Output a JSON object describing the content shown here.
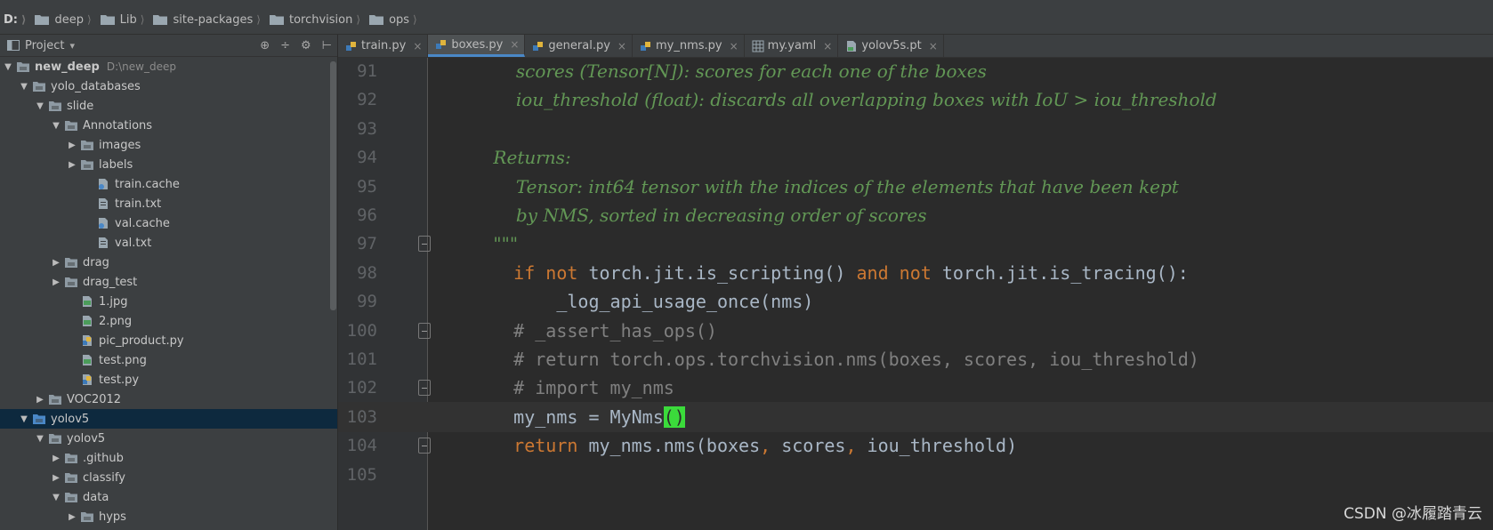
{
  "breadcrumb": [
    "D:",
    "deep",
    "Lib",
    "site-packages",
    "torchvision",
    "ops"
  ],
  "sidebar": {
    "title": "Project",
    "title_caret": "▾",
    "tools": [
      "⊕",
      "÷",
      "⚙",
      "⊢"
    ],
    "tree": [
      {
        "label": "new_deep",
        "sub": "D:\\new_deep",
        "depth": 0,
        "arrow": "▼",
        "icon": "folder",
        "bold": true
      },
      {
        "label": "yolo_databases",
        "depth": 1,
        "arrow": "▼",
        "icon": "folder"
      },
      {
        "label": "slide",
        "depth": 2,
        "arrow": "▼",
        "icon": "folder"
      },
      {
        "label": "Annotations",
        "depth": 3,
        "arrow": "▼",
        "icon": "folder"
      },
      {
        "label": "images",
        "depth": 4,
        "arrow": "▶",
        "icon": "folder"
      },
      {
        "label": "labels",
        "depth": 4,
        "arrow": "▶",
        "icon": "folder"
      },
      {
        "label": "train.cache",
        "depth": 5,
        "arrow": "",
        "icon": "file-gear"
      },
      {
        "label": "train.txt",
        "depth": 5,
        "arrow": "",
        "icon": "file-text"
      },
      {
        "label": "val.cache",
        "depth": 5,
        "arrow": "",
        "icon": "file-gear"
      },
      {
        "label": "val.txt",
        "depth": 5,
        "arrow": "",
        "icon": "file-text"
      },
      {
        "label": "drag",
        "depth": 3,
        "arrow": "▶",
        "icon": "folder"
      },
      {
        "label": "drag_test",
        "depth": 3,
        "arrow": "▶",
        "icon": "folder"
      },
      {
        "label": "1.jpg",
        "depth": 4,
        "arrow": "",
        "icon": "file-image"
      },
      {
        "label": "2.png",
        "depth": 4,
        "arrow": "",
        "icon": "file-image"
      },
      {
        "label": "pic_product.py",
        "depth": 4,
        "arrow": "",
        "icon": "file-python"
      },
      {
        "label": "test.png",
        "depth": 4,
        "arrow": "",
        "icon": "file-image"
      },
      {
        "label": "test.py",
        "depth": 4,
        "arrow": "",
        "icon": "file-python"
      },
      {
        "label": "VOC2012",
        "depth": 2,
        "arrow": "▶",
        "icon": "folder"
      },
      {
        "label": "yolov5",
        "depth": 1,
        "arrow": "▼",
        "icon": "folder-blue",
        "selected": true
      },
      {
        "label": "yolov5",
        "depth": 2,
        "arrow": "▼",
        "icon": "folder"
      },
      {
        "label": ".github",
        "depth": 3,
        "arrow": "▶",
        "icon": "folder"
      },
      {
        "label": "classify",
        "depth": 3,
        "arrow": "▶",
        "icon": "folder"
      },
      {
        "label": "data",
        "depth": 3,
        "arrow": "▼",
        "icon": "folder"
      },
      {
        "label": "hyps",
        "depth": 4,
        "arrow": "▶",
        "icon": "folder"
      }
    ]
  },
  "tabs": [
    {
      "label": "train.py",
      "icon": "python",
      "active": false
    },
    {
      "label": "boxes.py",
      "icon": "python",
      "active": true
    },
    {
      "label": "general.py",
      "icon": "python",
      "active": false
    },
    {
      "label": "my_nms.py",
      "icon": "python",
      "active": false
    },
    {
      "label": "my.yaml",
      "icon": "yaml",
      "active": false
    },
    {
      "label": "yolov5s.pt",
      "icon": "pt",
      "active": false
    }
  ],
  "tab_close": "×",
  "editor": {
    "lines": [
      {
        "num": "91",
        "segments": [
          {
            "t": "        scores (Tensor[N]): scores for each one of the boxes",
            "c": "doc"
          }
        ]
      },
      {
        "num": "92",
        "segments": [
          {
            "t": "        iou_threshold (float): discards all overlapping boxes with IoU > iou_threshold",
            "c": "doc"
          }
        ]
      },
      {
        "num": "93",
        "segments": []
      },
      {
        "num": "94",
        "segments": [
          {
            "t": "    Returns:",
            "c": "doc"
          }
        ]
      },
      {
        "num": "95",
        "segments": [
          {
            "t": "        Tensor: int64 tensor with the indices of the elements that have been kept",
            "c": "doc"
          }
        ]
      },
      {
        "num": "96",
        "segments": [
          {
            "t": "        by NMS, sorted in decreasing order of scores",
            "c": "doc"
          }
        ]
      },
      {
        "num": "97",
        "segments": [
          {
            "t": "    \"\"\"",
            "c": "doc"
          }
        ],
        "fold": true
      },
      {
        "num": "98",
        "segments": [
          {
            "t": "    if",
            "c": "kw"
          },
          {
            "t": " ",
            "c": "txt"
          },
          {
            "t": "not",
            "c": "kw"
          },
          {
            "t": " torch.jit.is_scripting() ",
            "c": "txt"
          },
          {
            "t": "and",
            "c": "kw"
          },
          {
            "t": " ",
            "c": "txt"
          },
          {
            "t": "not",
            "c": "kw"
          },
          {
            "t": " torch.jit.is_tracing():",
            "c": "txt"
          }
        ]
      },
      {
        "num": "99",
        "segments": [
          {
            "t": "        _log_api_usage_once(nms)",
            "c": "txt"
          }
        ]
      },
      {
        "num": "100",
        "segments": [
          {
            "t": "    # _assert_has_ops()",
            "c": "cmt"
          }
        ],
        "fold": true
      },
      {
        "num": "101",
        "segments": [
          {
            "t": "    # return torch.ops.torchvision.nms(boxes, scores, iou_threshold)",
            "c": "cmt"
          }
        ]
      },
      {
        "num": "102",
        "segments": [
          {
            "t": "    # import my_nms",
            "c": "cmt"
          }
        ],
        "fold": true
      },
      {
        "num": "103",
        "segments": [
          {
            "t": "    my_nms = MyNms",
            "c": "txt"
          },
          {
            "t": "()",
            "c": "brace"
          }
        ],
        "current": true
      },
      {
        "num": "104",
        "segments": [
          {
            "t": "    return",
            "c": "kw"
          },
          {
            "t": " my_nms.nms(boxes",
            "c": "txt"
          },
          {
            "t": ",",
            "c": "kw"
          },
          {
            "t": " scores",
            "c": "txt"
          },
          {
            "t": ",",
            "c": "kw"
          },
          {
            "t": " iou_threshold)",
            "c": "txt"
          }
        ],
        "fold": true
      },
      {
        "num": "105",
        "segments": []
      }
    ]
  },
  "watermark": "CSDN @冰履踏青云",
  "colors": {
    "keyword": "#cc7832",
    "docstring": "#629755",
    "comment": "#808080",
    "text": "#a9b7c6",
    "brace_match": "#3bdb3b",
    "selection": "#0d293e"
  }
}
